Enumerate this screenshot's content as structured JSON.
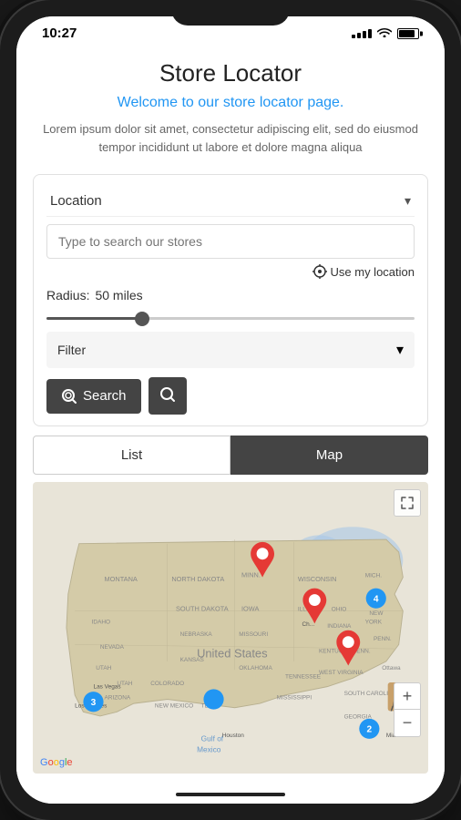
{
  "status": {
    "time": "10:27"
  },
  "header": {
    "title": "Store Locator",
    "subtitle": "Welcome to our store locator page.",
    "description": "Lorem ipsum dolor sit amet, consectetur adipiscing elit, sed do eiusmod tempor incididunt ut labore et dolore magna aliqua"
  },
  "search_panel": {
    "location_label": "Location",
    "search_placeholder": "Type to search our stores",
    "use_location_label": "Use my location",
    "radius_label": "Radius:",
    "radius_value": "50 miles",
    "filter_label": "Filter",
    "search_button_label": "Search"
  },
  "tabs": {
    "list_label": "List",
    "map_label": "Map",
    "active": "map"
  },
  "map": {
    "expand_icon": "⤢",
    "zoom_in_label": "+",
    "zoom_out_label": "−",
    "google_letters": [
      "G",
      "o",
      "o",
      "g",
      "l",
      "e"
    ]
  }
}
